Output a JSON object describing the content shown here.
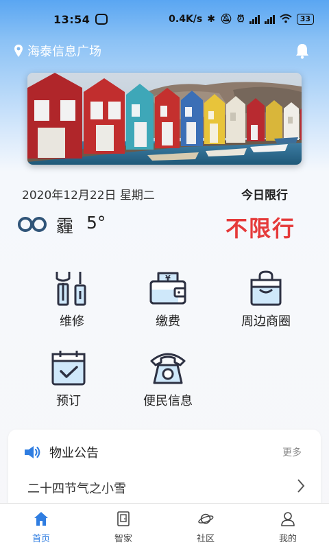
{
  "status_bar": {
    "time": "13:54",
    "network_speed": "0.4K/s",
    "battery": "33",
    "icons": [
      "chat-icon",
      "bluetooth-icon",
      "mute-icon",
      "alarm-icon",
      "signal-hd-icon",
      "signal-hd-icon",
      "wifi-icon",
      "battery-icon"
    ]
  },
  "header": {
    "location": "海泰信息广场"
  },
  "info": {
    "date": "2020年12月22日 星期二",
    "weather_condition": "霾",
    "temperature": "5°",
    "limit_title": "今日限行",
    "limit_value": "不限行"
  },
  "services": [
    {
      "label": "维修",
      "icon": "repair-tools-icon"
    },
    {
      "label": "缴费",
      "icon": "payment-wallet-icon"
    },
    {
      "label": "周边商圈",
      "icon": "shopping-bag-icon"
    },
    {
      "label": "预订",
      "icon": "calendar-check-icon"
    },
    {
      "label": "便民信息",
      "icon": "telephone-icon"
    }
  ],
  "notice": {
    "title": "物业公告",
    "more": "更多",
    "items": [
      "二十四节气之小雪"
    ]
  },
  "tabs": [
    {
      "label": "首页",
      "icon": "home-icon",
      "active": true
    },
    {
      "label": "智家",
      "icon": "smart-home-icon",
      "active": false
    },
    {
      "label": "社区",
      "icon": "planet-icon",
      "active": false
    },
    {
      "label": "我的",
      "icon": "user-icon",
      "active": false
    }
  ],
  "colors": {
    "accent": "#2f7de1",
    "limit_red": "#e53a3a",
    "icon_fill": "#cfe8fa",
    "icon_stroke": "#2d3142"
  }
}
